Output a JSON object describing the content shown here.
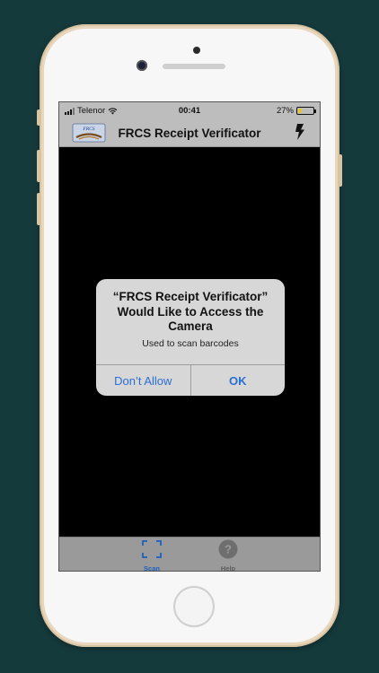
{
  "status_bar": {
    "carrier": "Telenor",
    "time": "00:41",
    "battery_percent": "27%",
    "battery_level": 0.27
  },
  "nav": {
    "title": "FRCS Receipt Verificator",
    "flash_icon": "flash-icon",
    "logo_icon": "frcs-logo"
  },
  "alert": {
    "title": "“FRCS Receipt Verificator” Would Like to Access the Camera",
    "message": "Used to scan barcodes",
    "deny_label": "Don’t Allow",
    "ok_label": "OK"
  },
  "tabs": [
    {
      "label": "Scan",
      "icon": "scan-icon",
      "selected": true
    },
    {
      "label": "Help",
      "icon": "help-icon",
      "selected": false
    }
  ],
  "colors": {
    "background": "#153a3c",
    "accent": "#2a6fd6",
    "battery": "#e6c42c",
    "phone_frame": "#e8d7bd"
  }
}
